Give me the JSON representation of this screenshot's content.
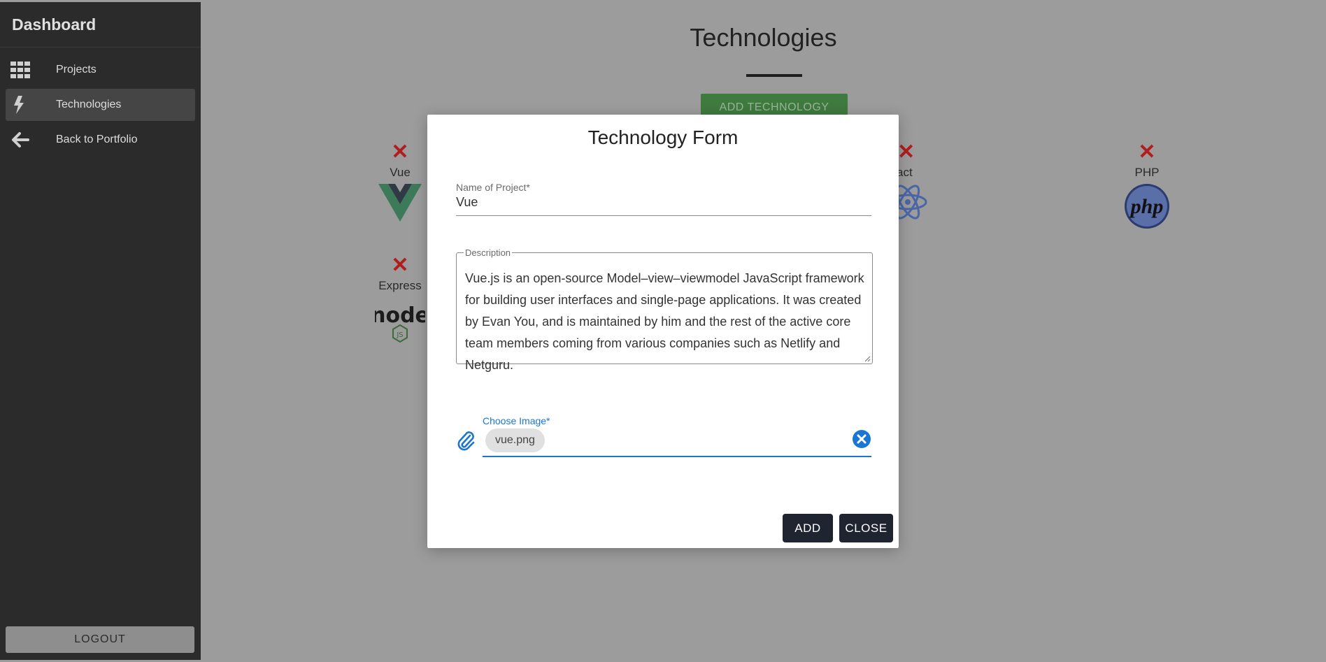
{
  "sidebar": {
    "brand": "Dashboard",
    "items": [
      {
        "label": "Projects",
        "icon": "grid-icon"
      },
      {
        "label": "Technologies",
        "icon": "bolt-icon",
        "active": true
      },
      {
        "label": "Back to Portfolio",
        "icon": "arrow-left-icon"
      }
    ],
    "logout_label": "LOGOUT"
  },
  "main": {
    "title": "Technologies",
    "add_button_label": "ADD TECHNOLOGY",
    "technologies": [
      {
        "name": "Vue",
        "logo": "vue-logo"
      },
      {
        "name": "act",
        "logo": "react-logo"
      },
      {
        "name": "PHP",
        "logo": "php-logo"
      },
      {
        "name": "Express",
        "logo": "node-logo"
      }
    ]
  },
  "modal": {
    "title": "Technology Form",
    "name_label": "Name of Project*",
    "name_value": "Vue",
    "description_label": "Description",
    "description_value": "Vue.js is an open-source Model–view–viewmodel JavaScript framework for building user interfaces and single-page applications. It was created by Evan You, and is maintained by him and the rest of the active core team members coming from various companies such as Netlify and Netguru.",
    "image_label": "Choose Image*",
    "image_file": "vue.png",
    "add_label": "ADD",
    "close_label": "CLOSE"
  },
  "colors": {
    "sidebar_bg": "#2b2b2b",
    "overlay_bg": "#9c9c9c",
    "accent_blue": "#1976d2",
    "delete_red": "#b01d1d",
    "button_dark": "#1e2430"
  }
}
